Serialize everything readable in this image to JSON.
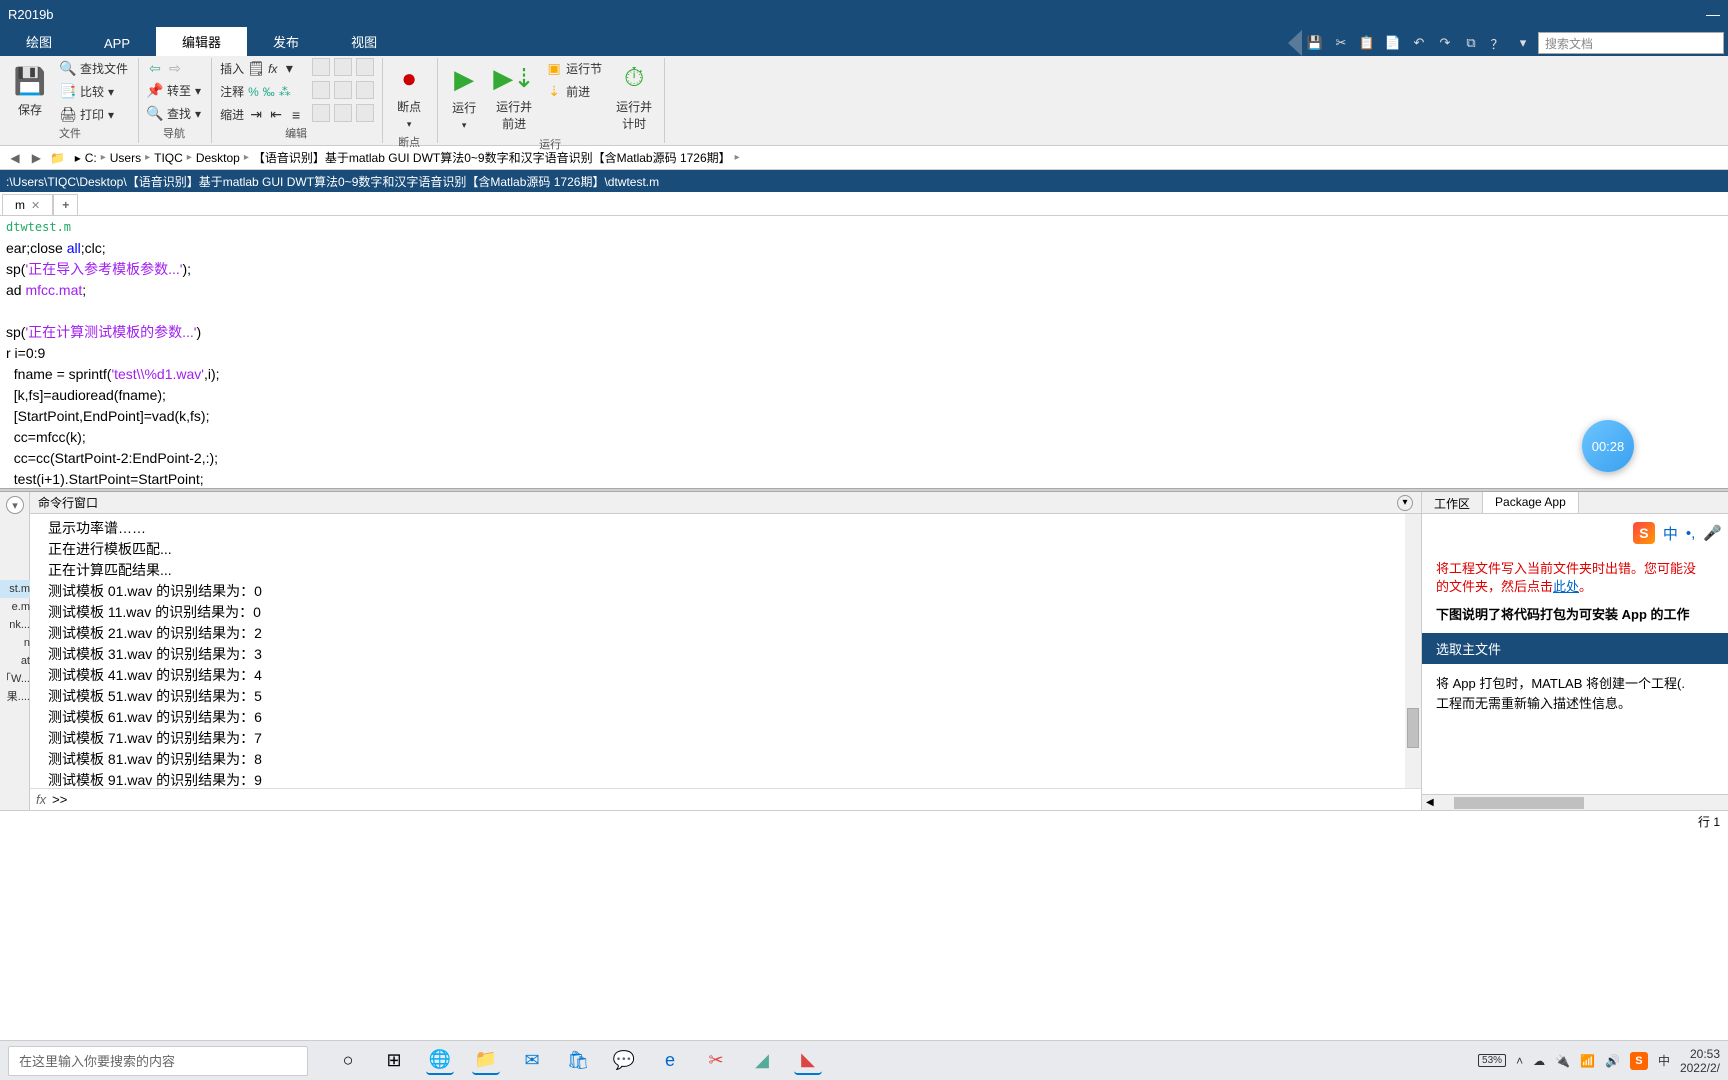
{
  "title": "R2019b",
  "tabs": [
    "绘图",
    "APP",
    "编辑器",
    "发布",
    "视图"
  ],
  "active_tab": 2,
  "search_placeholder": "搜索文档",
  "ribbon": {
    "file": {
      "label": "文件",
      "save": "保存",
      "findfiles": "查找文件",
      "compare": "比较",
      "print": "打印"
    },
    "nav": {
      "label": "导航",
      "goto": "转至",
      "find": "查找"
    },
    "edit": {
      "label": "编辑",
      "insert": "插入",
      "comment": "注释",
      "indent": "缩进"
    },
    "breakpoint": {
      "label": "断点",
      "btn": "断点"
    },
    "run": {
      "label": "运行",
      "run": "运行",
      "run_advance": "运行并\n前进",
      "run_section": "运行节",
      "advance": "前进",
      "run_time": "运行并\n计时"
    }
  },
  "path_crumbs": [
    "C:",
    "Users",
    "TIQC",
    "Desktop",
    "【语音识别】基于matlab GUI DWT算法0~9数字和汉字语音识别【含Matlab源码 1726期】"
  ],
  "current_path": ":\\Users\\TIQC\\Desktop\\【语音识别】基于matlab GUI DWT算法0~9数字和汉字语音识别【含Matlab源码 1726期】\\dtwtest.m",
  "file_tab": "m",
  "editor_breadcrumb": "dtwtest.m",
  "code_lines": [
    {
      "t": "ear;close all;clc;",
      "parts": [
        {
          "c": "",
          "s": "ear;close "
        },
        {
          "c": "kw",
          "s": "all"
        },
        {
          "c": "",
          "s": ";clc;"
        }
      ]
    },
    {
      "t": "sp('正在导入参考模板参数...');",
      "parts": [
        {
          "c": "",
          "s": "sp("
        },
        {
          "c": "str",
          "s": "'正在导入参考模板参数...'"
        },
        {
          "c": "",
          "s": ");"
        }
      ]
    },
    {
      "t": "ad mfcc.mat;",
      "parts": [
        {
          "c": "",
          "s": "ad "
        },
        {
          "c": "str",
          "s": "mfcc.mat"
        },
        {
          "c": "",
          "s": ";"
        }
      ]
    },
    {
      "t": "",
      "parts": [
        {
          "c": "",
          "s": " "
        }
      ]
    },
    {
      "t": "sp('正在计算测试模板的参数...')",
      "parts": [
        {
          "c": "",
          "s": "sp("
        },
        {
          "c": "str",
          "s": "'正在计算测试模板的参数...'"
        },
        {
          "c": "",
          "s": ")"
        }
      ]
    },
    {
      "t": "r i=0:9",
      "parts": [
        {
          "c": "",
          "s": "r i=0:9"
        }
      ]
    },
    {
      "t": "  fname = sprintf('test\\\\%d1.wav',i);",
      "parts": [
        {
          "c": "",
          "s": "  fname = sprintf("
        },
        {
          "c": "str",
          "s": "'test\\\\%d1.wav'"
        },
        {
          "c": "",
          "s": ",i);"
        }
      ]
    },
    {
      "t": "  [k,fs]=audioread(fname);",
      "parts": [
        {
          "c": "",
          "s": "  [k,fs]=audioread(fname);"
        }
      ]
    },
    {
      "t": "  [StartPoint,EndPoint]=vad(k,fs);",
      "parts": [
        {
          "c": "",
          "s": "  [StartPoint,EndPoint]=vad(k,fs);"
        }
      ]
    },
    {
      "t": "  cc=mfcc(k);",
      "parts": [
        {
          "c": "",
          "s": "  cc=mfcc(k);"
        }
      ]
    },
    {
      "t": "  cc=cc(StartPoint-2:EndPoint-2,:);",
      "parts": [
        {
          "c": "",
          "s": "  cc=cc(StartPoint-2:EndPoint-2,:);"
        }
      ]
    },
    {
      "t": "  test(i+1).StartPoint=StartPoint;",
      "parts": [
        {
          "c": "",
          "s": "  test(i+1).StartPoint=StartPoint;"
        }
      ]
    }
  ],
  "left_files": [
    "st.m",
    "e.m",
    "nk...",
    "n",
    "at",
    "",
    "「W...",
    "果...."
  ],
  "cmd_title": "命令行窗口",
  "cmd_output": [
    "显示功率谱……",
    "正在进行模板匹配...",
    "正在计算匹配结果...",
    "测试模板 01.wav 的识别结果为：0",
    "测试模板 11.wav 的识别结果为：0",
    "测试模板 21.wav 的识别结果为：2",
    "测试模板 31.wav 的识别结果为：3",
    "测试模板 41.wav 的识别结果为：4",
    "测试模板 51.wav 的识别结果为：5",
    "测试模板 61.wav 的识别结果为：6",
    "测试模板 71.wav 的识别结果为：7",
    "测试模板 81.wav 的识别结果为：8",
    "测试模板 91.wav 的识别结果为：9"
  ],
  "prompt": ">>",
  "workspace_tab": "工作区",
  "package_tab": "Package App",
  "ime_cn": "中",
  "error_text": "将工程文件写入当前文件夹时出错。您可能没",
  "error_text2": "的文件夹，然后点击",
  "error_link": "此处",
  "help_header": "下图说明了将代码打包为可安装 App 的工作",
  "blue_header": "选取主文件",
  "help_body1": "将 App 打包时，MATLAB 将创建一个工程(.",
  "help_body2": "工程而无需重新输入描述性信息。",
  "status_line": "行  1",
  "win_search": "在这里输入你要搜索的内容",
  "battery": "53%",
  "clock_time": "20:53",
  "clock_date": "2022/2/",
  "timer": "00:28"
}
